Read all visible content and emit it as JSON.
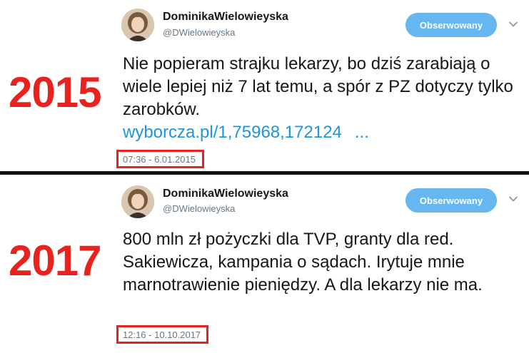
{
  "tweets": [
    {
      "year_label": "2015",
      "account": {
        "display_name": "DominikaWielowieyska",
        "handle": "@DWielowieyska"
      },
      "follow_button_label": "Obserwowany",
      "text": "Nie popieram strajku lekarzy, bo dziś zarabiają o wiele lepiej niż 7 lat temu, a spór z PZ dotyczy tylko zarobków.",
      "link": {
        "text": "wyborcza.pl/1,75968,172124",
        "ellipsis": "..."
      },
      "timestamp": "07:36 - 6.01.2015"
    },
    {
      "year_label": "2017",
      "account": {
        "display_name": "DominikaWielowieyska",
        "handle": "@DWielowieyska"
      },
      "follow_button_label": "Obserwowany",
      "text": "800 mln zł pożyczki dla TVP, granty dla red. Sakiewicza, kampania o sądach. Irytuje mnie marnotrawienie pieniędzy. A dla lekarzy nie ma.",
      "timestamp": "12:16 - 10.10.2017"
    }
  ],
  "colors": {
    "year_red": "#e8231f",
    "follow_button_bg": "#66b6f0",
    "link_blue": "#1b95e0",
    "handle_gray": "#657786",
    "divider": "#111111"
  },
  "icons": {
    "avatar": "profile-photo",
    "menu": "chevron-down-icon"
  }
}
